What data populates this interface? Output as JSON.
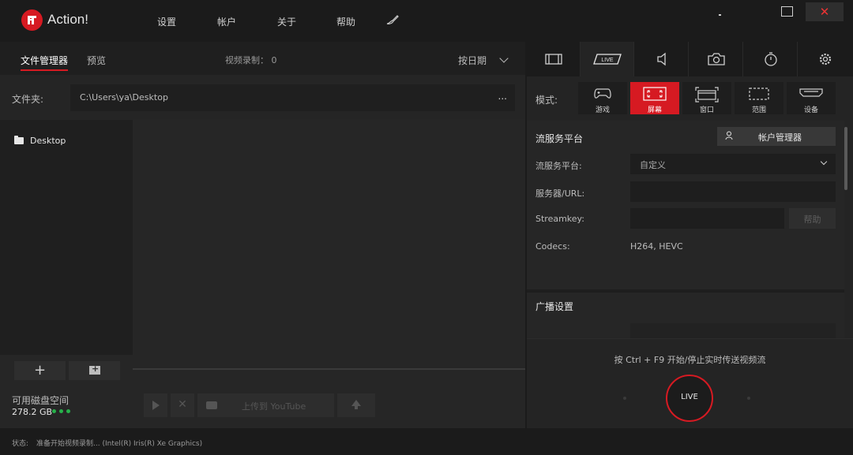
{
  "app": {
    "title": "Action!"
  },
  "menu": {
    "settings": "设置",
    "account": "帐户",
    "about": "关于",
    "help": "帮助"
  },
  "left": {
    "tabs": {
      "file_manager": "文件管理器",
      "preview": "预览"
    },
    "recording_count": "视频录制： 0",
    "sort_label": "按日期",
    "folder_label": "文件夹:",
    "folder_path": "C:\\Users\\ya\\Desktop",
    "folder_more": "...",
    "tree": [
      {
        "label": "Desktop"
      }
    ],
    "add_label": "+",
    "disk_label": "可用磁盘空间",
    "disk_value": "278.2 GB",
    "upload_label": "上传到 YouTube"
  },
  "right": {
    "mode_label": "模式:",
    "modes": [
      {
        "label": "游戏",
        "active": false
      },
      {
        "label": "屏幕",
        "active": true
      },
      {
        "label": "窗口",
        "active": false
      },
      {
        "label": "范围",
        "active": false
      },
      {
        "label": "设备",
        "active": false
      }
    ],
    "streaming": {
      "section_title": "流服务平台",
      "account_button": "帐户管理器",
      "platform_label": "流服务平台:",
      "platform_value": "自定义",
      "server_label": "服务器/URL:",
      "server_value": "",
      "streamkey_label": "Streamkey:",
      "streamkey_value": "",
      "help_button": "帮助",
      "codecs_label": "Codecs:",
      "codecs_value": "H264, HEVC"
    },
    "broadcast": {
      "section_title": "广播设置"
    },
    "live_hint": "按 Ctrl + F9 开始/停止实时传送视频流",
    "live_button": "LIVE",
    "live_tab_label": "LIVE"
  },
  "status": {
    "label": "状态:",
    "text": "准备开始视频录制... (Intel(R) Iris(R) Xe Graphics)"
  },
  "colors": {
    "accent": "#d61a22",
    "disk_ok": "#27b24a"
  }
}
